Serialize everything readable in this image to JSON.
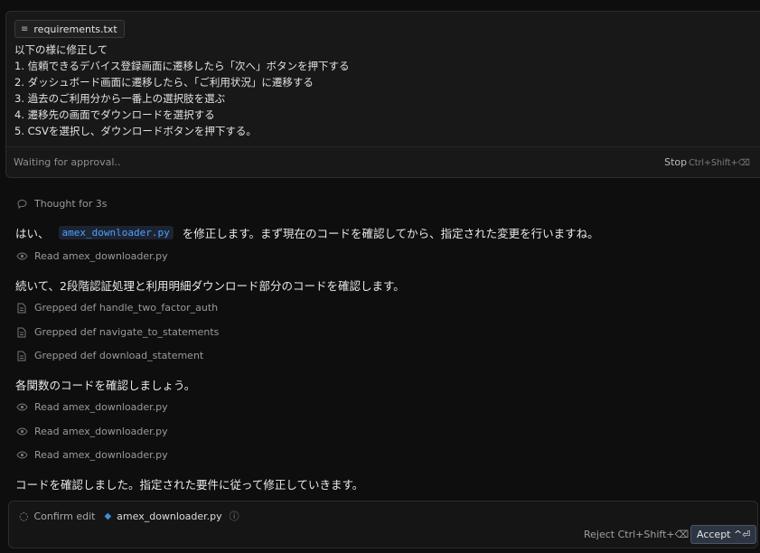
{
  "message": {
    "attachment": {
      "icon": "list-icon",
      "name": "requirements.txt"
    },
    "lines": [
      "以下の様に修正して",
      "1. 信頼できるデバイス登録画面に遷移したら「次へ」ボタンを押下する",
      "2. ダッシュボード画面に遷移したら、「ご利用状況」に遷移する",
      "3. 過去のご利用分から一番上の選択肢を選ぶ",
      "4. 遷移先の画面でダウンロードを選択する",
      "5. CSVを選択し、ダウンロードボタンを押下する。"
    ],
    "status": "Waiting for approval..",
    "stop_label": "Stop",
    "stop_shortcut": "Ctrl+Shift+⌫"
  },
  "conversation": {
    "thought": "Thought for 3s",
    "text1_pre": "はい、",
    "text1_code": "amex_downloader.py",
    "text1_post": "を修正します。まず現在のコードを確認してから、指定された変更を行いますね。",
    "read1": "Read amex_downloader.py",
    "text2": "続いて、2段階認証処理と利用明細ダウンロード部分のコードを確認します。",
    "grep1": "Grepped def handle_two_factor_auth",
    "grep2": "Grepped def navigate_to_statements",
    "grep3": "Grepped def download_statement",
    "text3": "各関数のコードを確認しましょう。",
    "read2": "Read amex_downloader.py",
    "read3": "Read amex_downloader.py",
    "read4": "Read amex_downloader.py",
    "text4": "コードを確認しました。指定された要件に従って修正していきます。"
  },
  "confirm": {
    "label": "Confirm edit",
    "file": "amex_downloader.py",
    "reject": "Reject Ctrl+Shift+⌫",
    "accept": "Accept ^⏎"
  },
  "colors": {
    "accent": "#4aa3ff",
    "background": "#0e0e0e",
    "panel": "#181818"
  }
}
